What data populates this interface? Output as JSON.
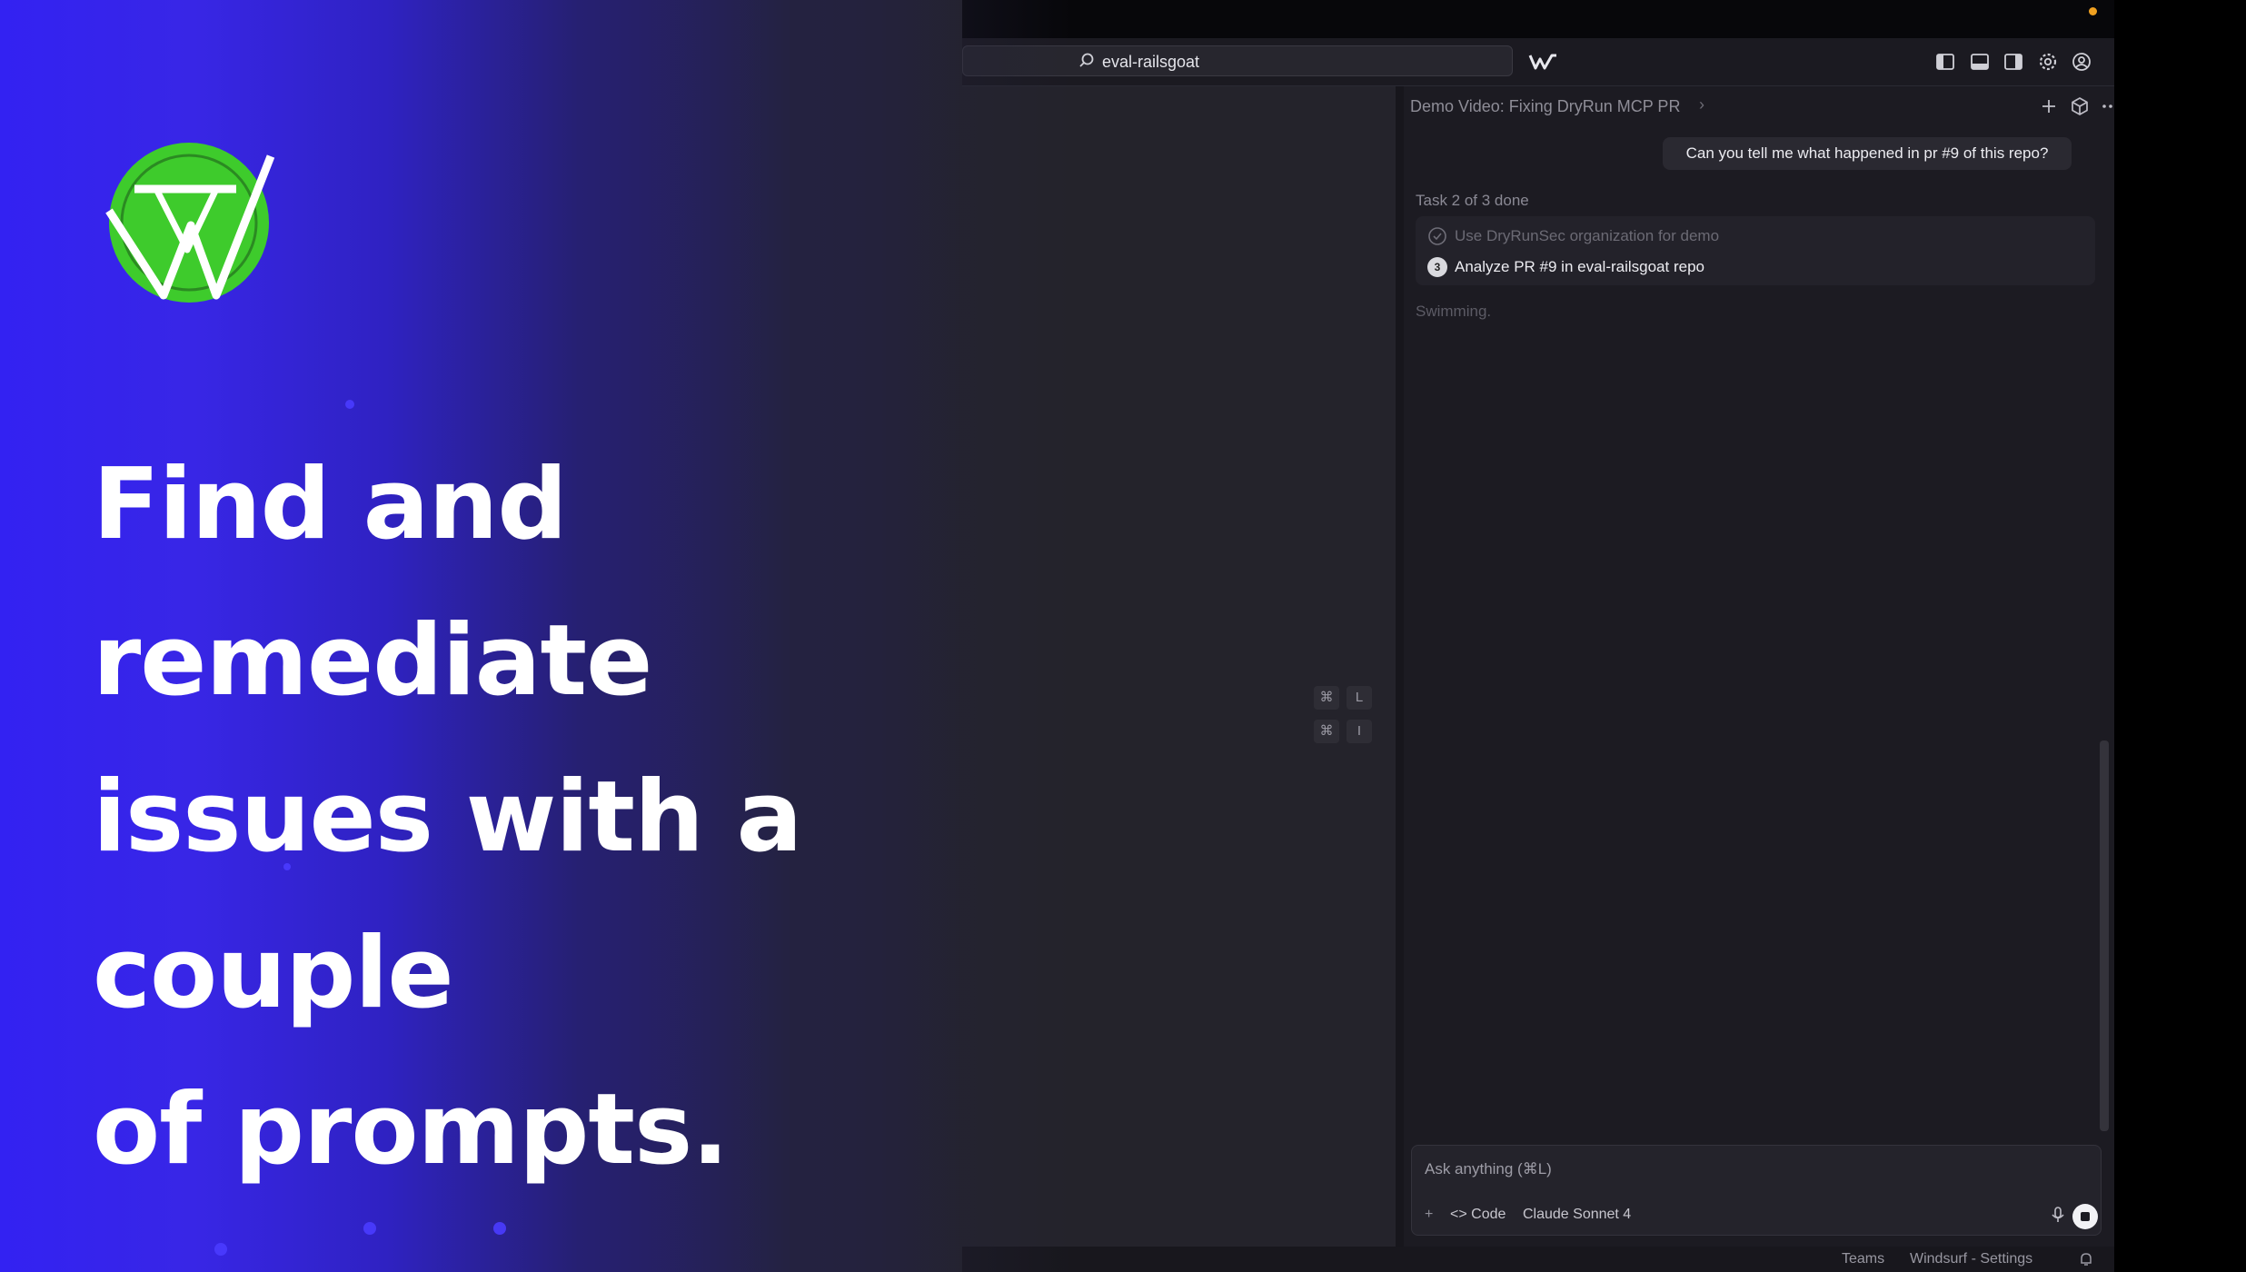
{
  "window": {
    "search_label": "eval-railsgoat"
  },
  "editor": {
    "shortcuts": [
      {
        "key1": "⌘",
        "key2": "L"
      },
      {
        "key1": "⌘",
        "key2": "I"
      }
    ]
  },
  "chat": {
    "title": "Demo Video: Fixing DryRun MCP PR",
    "user_message": "Can you tell me what happened in pr #9 of this repo?",
    "task_header": "Task 2 of 3 done",
    "tasks": [
      {
        "label": "Use DryRunSec organization for demo",
        "status": "done"
      },
      {
        "label": "Analyze PR #9 in eval-railsgoat repo",
        "status": "in-progress",
        "number": "3"
      }
    ],
    "status_text": "Swimming.",
    "input_placeholder": "Ask anything (⌘L)",
    "toolbar": {
      "add_label": "+",
      "code_label": "<> Code",
      "model_label": "Claude Sonnet 4"
    }
  },
  "statusbar": {
    "teams_label": "Teams",
    "settings_label": "Windsurf - Settings"
  },
  "promo": {
    "headline": "Find and  remediate\nissues with a couple\nof prompts."
  },
  "colors": {
    "overlay_blue": "#3322f2",
    "logo_green": "#3ecb2c",
    "window_bg": "#1f1f26",
    "accent_orange": "#f0a020"
  }
}
